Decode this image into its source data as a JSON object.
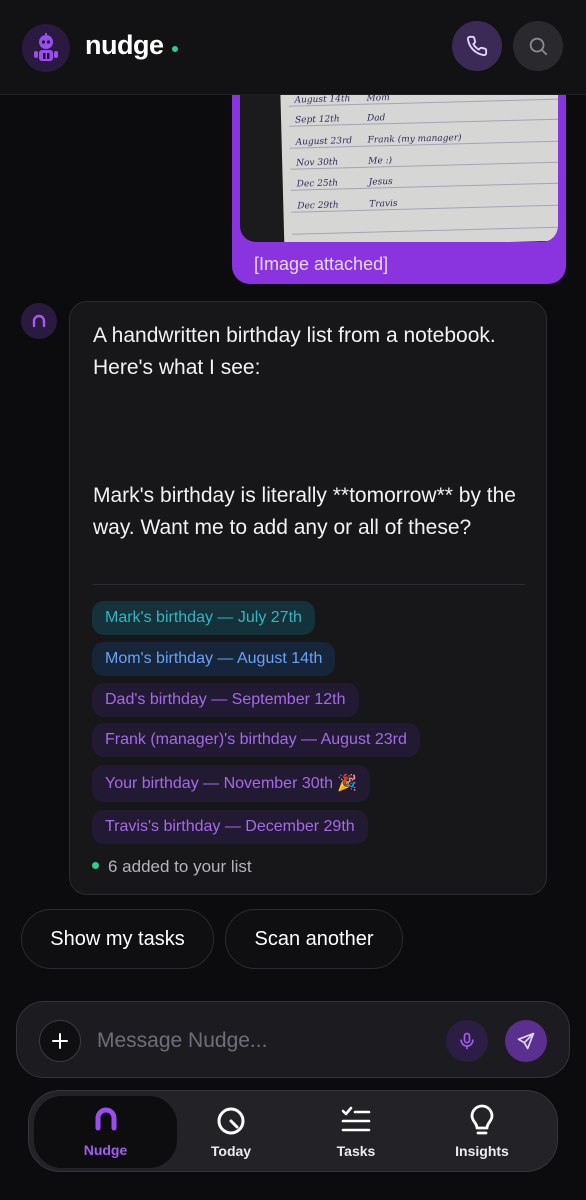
{
  "header": {
    "app_name": "nudge",
    "logo_icon": "robot-mascot-icon",
    "phone_icon": "phone-icon",
    "search_icon": "search-icon"
  },
  "image_message": {
    "caption": "[Image attached]",
    "handwriting": [
      {
        "date": "August 14th",
        "name": "Mom"
      },
      {
        "date": "Sept 12th",
        "name": "Dad"
      },
      {
        "date": "August 23rd",
        "name": "Frank (my manager)"
      },
      {
        "date": "Nov 30th",
        "name": "Me :)"
      },
      {
        "date": "Dec 25th",
        "name": "Jesus"
      },
      {
        "date": "Dec 29th",
        "name": "Travis"
      }
    ]
  },
  "assistant_message": {
    "intro": "A handwritten birthday list from a notebook. Here's what I see:",
    "followup": "Mark's birthday is literally **tomorrow** by the way. Want me to add any or all of these?",
    "chips": [
      {
        "label": "Mark's birthday — July 27th",
        "color": "#2fb7c4"
      },
      {
        "label": "Mom's birthday — August 14th",
        "color": "#6aa2f5"
      },
      {
        "label": "Dad's birthday — September 12th",
        "color": "#a46be8"
      },
      {
        "label": "Frank (manager)'s birthday — August 23rd",
        "color": "#a46be8"
      },
      {
        "label": "Your birthday — November 30th 🎉",
        "color": "#a46be8"
      },
      {
        "label": "Travis's birthday — December 29th",
        "color": "#a46be8"
      }
    ],
    "status": "6 added to your list"
  },
  "quick_replies": [
    "Show my tasks",
    "Scan another"
  ],
  "composer": {
    "placeholder": "Message Nudge..."
  },
  "nav": {
    "items": [
      {
        "label": "Nudge",
        "icon": "nudge-icon",
        "active": true
      },
      {
        "label": "Today",
        "icon": "gauge-icon",
        "active": false
      },
      {
        "label": "Tasks",
        "icon": "checklist-icon",
        "active": false
      },
      {
        "label": "Insights",
        "icon": "lightbulb-icon",
        "active": false
      }
    ]
  },
  "colors": {
    "accent": "#8a34e0",
    "status_dot": "#2ecc8f",
    "background": "#0c0c0e"
  }
}
